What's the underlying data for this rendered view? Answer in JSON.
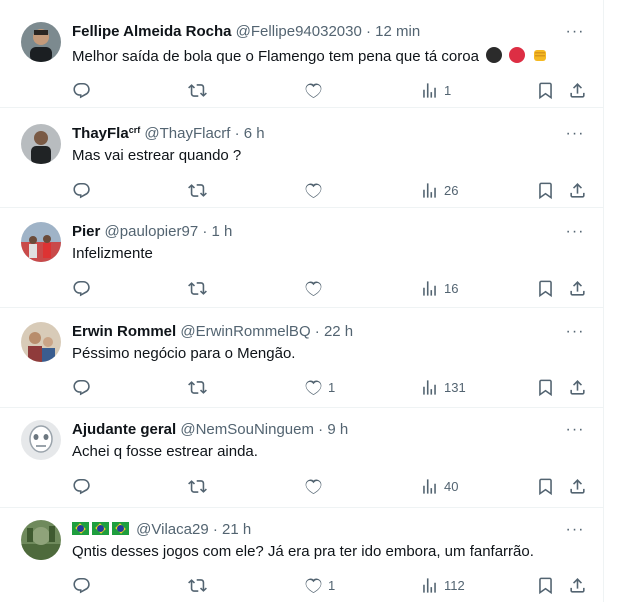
{
  "colors": {
    "text": "#0f1419",
    "muted": "#536471",
    "divider": "#eff3f4"
  },
  "replies": [
    {
      "name": "Fellipe Almeida Rocha",
      "name_sup": "",
      "handle": "@Fellipe94032030",
      "time": "12 min",
      "text": "Melhor saída de bola que o Flamengo tem pena que tá coroa",
      "emojis": [
        "black-circle",
        "red-circle",
        "fist"
      ],
      "likes": "",
      "views": "1"
    },
    {
      "name": "ThayFla",
      "name_sup": "crf",
      "handle": "@ThayFlacrf",
      "time": "6 h",
      "text": "Mas vai estrear quando ?",
      "likes": "",
      "views": "26"
    },
    {
      "name": "Pier",
      "name_sup": "",
      "handle": "@paulopier97",
      "time": "1 h",
      "text": "Infelizmente",
      "likes": "",
      "views": "16"
    },
    {
      "name": "Erwin Rommel",
      "name_sup": "",
      "handle": "@ErwinRommelBQ",
      "time": "22 h",
      "text": "Péssimo negócio para o Mengão.",
      "likes": "1",
      "views": "131"
    },
    {
      "name": "Ajudante geral",
      "name_sup": "",
      "handle": "@NemSouNinguem",
      "time": "9 h",
      "text": "Achei q fosse estrear ainda.",
      "likes": "",
      "views": "40"
    },
    {
      "name": "",
      "name_flags": [
        "brazil-flag",
        "brazil-flag",
        "brazil-flag"
      ],
      "name_sup": "",
      "handle": "@Vilaca29",
      "time": "21 h",
      "text": "Qntis desses jogos com ele? Já era pra ter ido embora, um fanfarrão.",
      "likes": "1",
      "views": "112"
    }
  ],
  "sep": "·",
  "more_label": "···"
}
